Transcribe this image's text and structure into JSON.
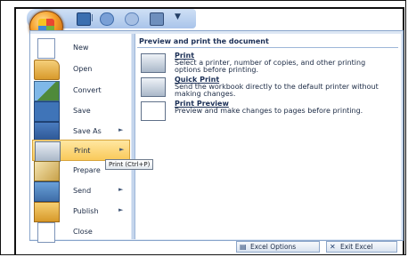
{
  "quick_access": {
    "icons": [
      "office-button-icon",
      "save-icon",
      "undo-icon",
      "redo-icon",
      "quick-print-icon",
      "customize-icon"
    ]
  },
  "menu": {
    "items": [
      {
        "label": "New",
        "icon": "new-document-icon",
        "arrow": ""
      },
      {
        "label": "Open",
        "icon": "open-folder-icon",
        "arrow": ""
      },
      {
        "label": "Convert",
        "icon": "convert-icon",
        "arrow": ""
      },
      {
        "label": "Save",
        "icon": "save-disk-icon",
        "arrow": ""
      },
      {
        "label": "Save As",
        "icon": "save-as-icon",
        "arrow": "►"
      },
      {
        "label": "Print",
        "icon": "printer-icon",
        "arrow": "►"
      },
      {
        "label": "Prepare",
        "icon": "prepare-icon",
        "arrow": ""
      },
      {
        "label": "Send",
        "icon": "send-icon",
        "arrow": "►"
      },
      {
        "label": "Publish",
        "icon": "publish-icon",
        "arrow": "►"
      },
      {
        "label": "Close",
        "icon": "close-document-icon",
        "arrow": ""
      }
    ],
    "active": "Print"
  },
  "submenu": {
    "header": "Preview and print the document",
    "options": [
      {
        "title": "Print",
        "desc": "Select a printer, number of copies, and other printing options before printing.",
        "icon": "printer-icon"
      },
      {
        "title": "Quick Print",
        "desc": "Send the workbook directly to the default printer without making changes.",
        "icon": "quick-print-icon"
      },
      {
        "title": "Print Preview",
        "desc": "Preview and make changes to pages before printing.",
        "icon": "print-preview-icon"
      }
    ]
  },
  "tooltip": "Print (Ctrl+P)",
  "footer": {
    "options_label": "Excel Options",
    "exit_label": "Exit Excel"
  }
}
